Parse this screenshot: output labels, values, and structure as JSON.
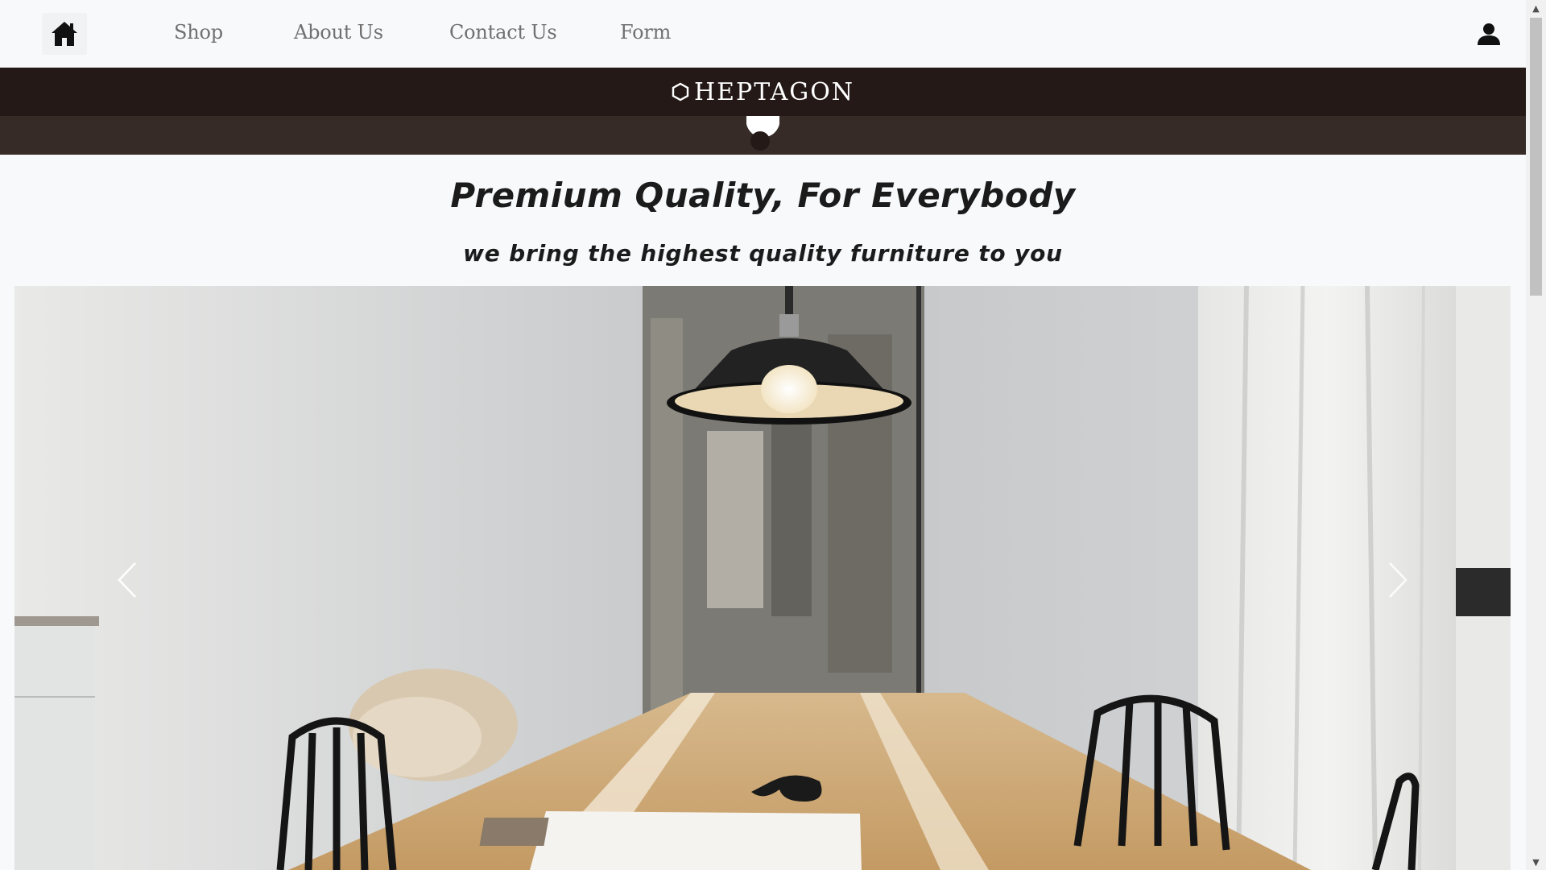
{
  "nav": {
    "home_icon": "home-icon",
    "links": [
      "Shop",
      "About Us",
      "Contact Us",
      "Form"
    ],
    "user_icon": "user-icon"
  },
  "brand": {
    "name": "HEPTAGON",
    "logo_icon": "hexagon-icon"
  },
  "hero": {
    "title": "Premium Quality, For Everybody",
    "subtitle": "we bring the highest quality furniture to you"
  },
  "carousel": {
    "prev_icon": "chevron-left-icon",
    "next_icon": "chevron-right-icon"
  },
  "colors": {
    "page_bg": "#f8f9fa",
    "brand_band": "#241916",
    "toggle_band": "#372b28",
    "nav_text": "#707070"
  }
}
